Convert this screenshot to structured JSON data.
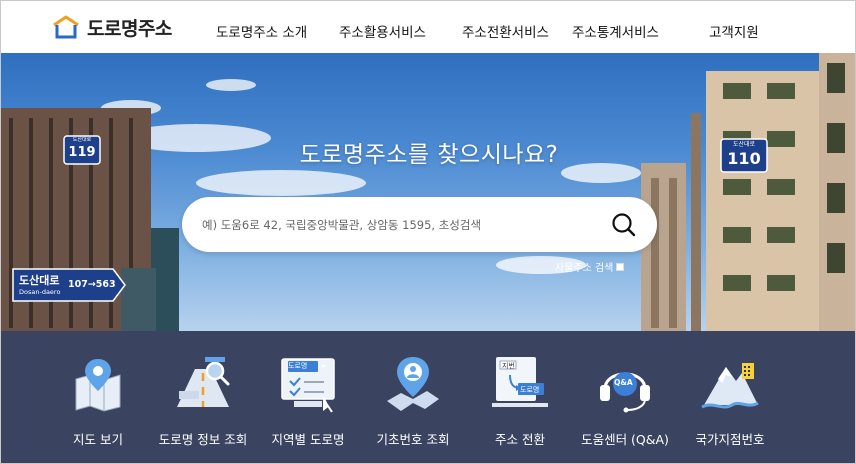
{
  "header": {
    "logo_text": "도로명주소",
    "nav": [
      {
        "label": "도로명주소 소개"
      },
      {
        "label": "주소활용서비스"
      },
      {
        "label": "주소전환서비스"
      },
      {
        "label": "주소통계서비스"
      },
      {
        "label": "고객지원"
      }
    ]
  },
  "hero": {
    "title": "도로명주소를 찾으시나요?",
    "search_placeholder": "예) 도움6로 42, 국립중앙박물관, 상암동 1595, 초성검색",
    "archive_label": "사물주소 검색",
    "signs": {
      "left_building": {
        "name": "도산대로",
        "number": "119"
      },
      "right_building": {
        "name": "도산대로",
        "number": "110"
      },
      "street": {
        "name_ko": "도산대로",
        "name_en": "Dosan-daero",
        "range": "107→563"
      }
    }
  },
  "quick_menu": [
    {
      "label": "지도 보기",
      "icon": "map-icon"
    },
    {
      "label": "도로명 정보 조회",
      "icon": "road-info-icon"
    },
    {
      "label": "지역별 도로명",
      "icon": "regional-road-icon"
    },
    {
      "label": "기초번호 조회",
      "icon": "base-number-icon"
    },
    {
      "label": "주소 전환",
      "icon": "address-convert-icon"
    },
    {
      "label": "도움센터 (Q&A)",
      "icon": "help-center-icon"
    },
    {
      "label": "국가지점번호",
      "icon": "national-point-icon"
    }
  ],
  "quick_icon_texts": {
    "regional_tag": "도로명",
    "convert_top": "지번",
    "convert_bottom": "도로명",
    "help_bubble": "Q&A"
  },
  "colors": {
    "accent_blue": "#3b7fd6",
    "bottom_bar": "#3a4460",
    "sign_blue": "#1e3f8a"
  }
}
